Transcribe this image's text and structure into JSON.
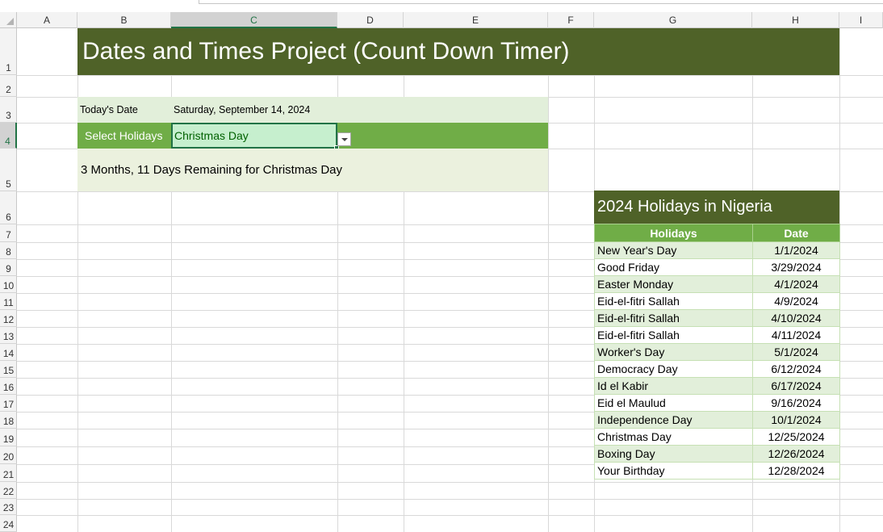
{
  "sheet": {
    "columns": [
      "A",
      "B",
      "C",
      "D",
      "E",
      "F",
      "G",
      "H",
      "I"
    ],
    "selected_column": "C",
    "rows": [
      "1",
      "2",
      "3",
      "4",
      "5",
      "6",
      "7",
      "8",
      "9",
      "10",
      "11",
      "12",
      "13",
      "14",
      "15",
      "16",
      "17",
      "18",
      "19",
      "20",
      "21",
      "22",
      "23",
      "24"
    ],
    "selected_row": "4"
  },
  "title": "Dates and Times Project (Count Down Timer)",
  "today": {
    "label": "Today's Date",
    "value": "Saturday, September 14, 2024"
  },
  "select": {
    "label": "Select Holidays",
    "value": "Christmas Day"
  },
  "countdown": "3 Months, 11 Days Remaining for Christmas Day",
  "holidays": {
    "title": "2024 Holidays in Nigeria",
    "headers": [
      "Holidays",
      "Date"
    ],
    "rows": [
      [
        "New Year's Day",
        "1/1/2024"
      ],
      [
        "Good Friday",
        "3/29/2024"
      ],
      [
        "Easter Monday",
        "4/1/2024"
      ],
      [
        "Eid-el-fitri Sallah",
        "4/9/2024"
      ],
      [
        "Eid-el-fitri Sallah",
        "4/10/2024"
      ],
      [
        "Eid-el-fitri Sallah",
        "4/11/2024"
      ],
      [
        "Worker's Day",
        "5/1/2024"
      ],
      [
        "Democracy Day",
        "6/12/2024"
      ],
      [
        "Id el Kabir",
        "6/17/2024"
      ],
      [
        "Eid el Maulud",
        "9/16/2024"
      ],
      [
        "Independence Day",
        "10/1/2024"
      ],
      [
        "Christmas Day",
        "12/25/2024"
      ],
      [
        "Boxing Day",
        "12/26/2024"
      ],
      [
        "Your Birthday",
        "12/28/2024"
      ]
    ]
  },
  "colors": {
    "dark_green": "#4f6228",
    "green": "#70ad47",
    "light_green": "#e2efda",
    "selection": "#217346"
  }
}
